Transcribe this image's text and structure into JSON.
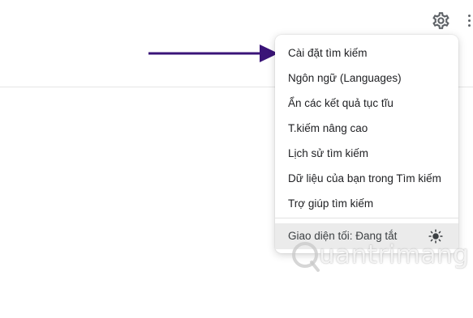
{
  "menu": {
    "items": [
      {
        "label": "Cài đặt tìm kiếm"
      },
      {
        "label": "Ngôn ngữ (Languages)"
      },
      {
        "label": "Ẩn các kết quả tục tĩu"
      },
      {
        "label": "T.kiếm nâng cao"
      },
      {
        "label": "Lịch sử tìm kiếm"
      },
      {
        "label": "Dữ liệu của bạn trong Tìm kiếm"
      },
      {
        "label": "Trợ giúp tìm kiếm"
      }
    ],
    "dark_theme_label": "Giao diện tối: Đang tắt",
    "dark_theme_icon": "sun-icon"
  },
  "icons": {
    "settings": "gear-icon",
    "more": "more-vertical-icon",
    "annotation": "arrow-right-icon"
  },
  "colors": {
    "arrow": "#3a1478",
    "icon": "#5f6368",
    "text": "#202124",
    "footer_bg": "#ebebeb"
  },
  "watermark": {
    "text": "uantrimang"
  }
}
